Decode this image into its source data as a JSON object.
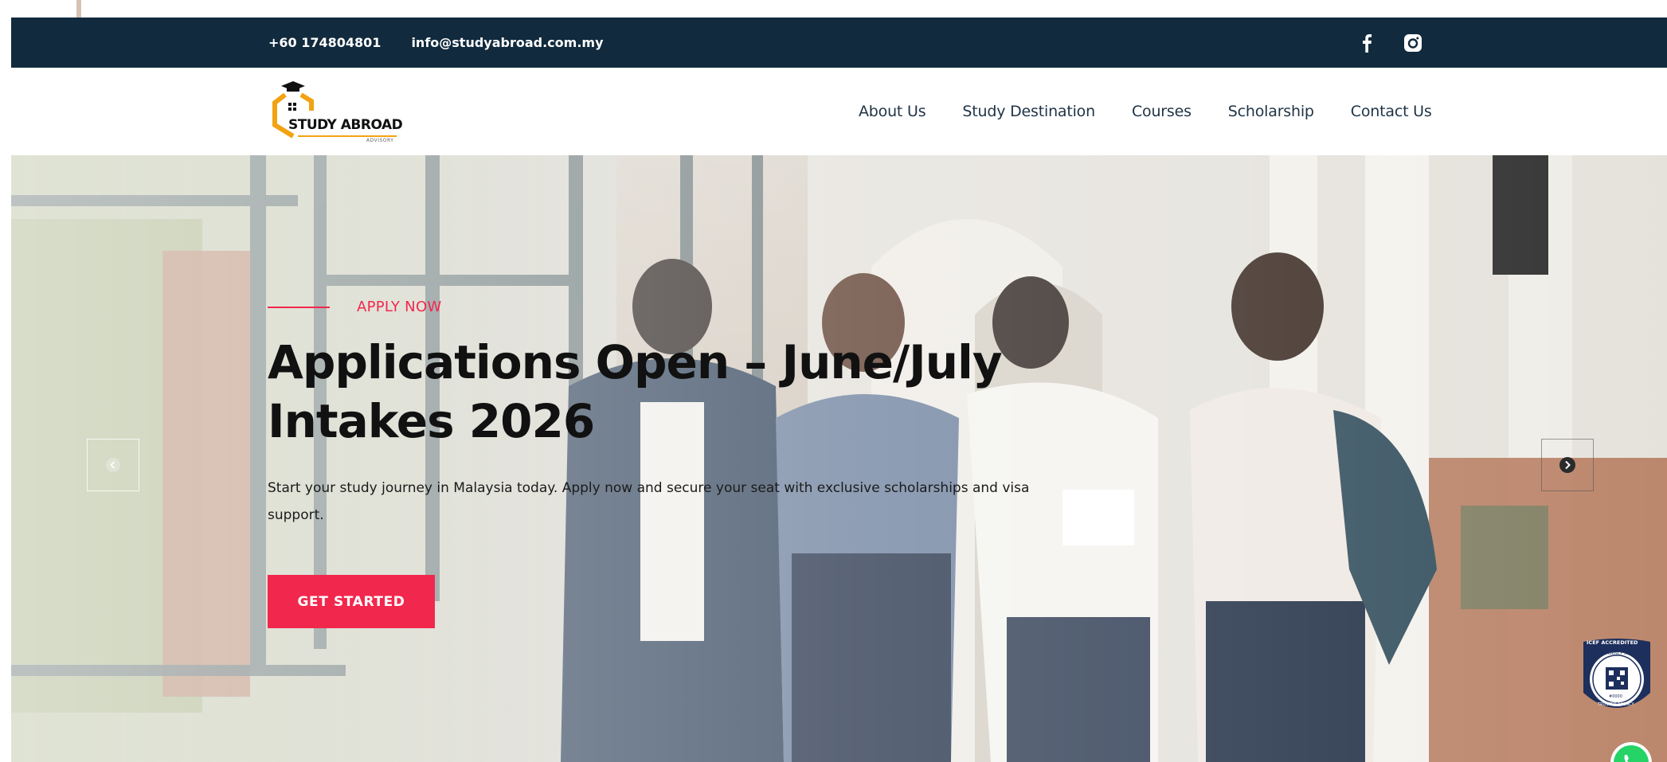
{
  "topbar": {
    "phone": "+60 174804801",
    "email": "info@studyabroad.com.my",
    "social": [
      {
        "icon": "facebook-icon"
      },
      {
        "icon": "instagram-icon"
      }
    ]
  },
  "logo": {
    "line1": "STUDY ABROAD",
    "line2": "ADVISORY"
  },
  "nav": {
    "items": [
      "About Us",
      "Study Destination",
      "Courses",
      "Scholarship",
      "Contact Us"
    ]
  },
  "hero": {
    "eyebrow": "APPLY NOW",
    "title_line1": "Applications Open – June/July",
    "title_line2": "Intakes 2026",
    "description": "Start your study journey in Malaysia today. Apply now and secure your seat with exclusive scholarships and visa support.",
    "cta": "GET STARTED"
  },
  "badge": {
    "top_text": "ICEF ACCREDITED",
    "ring_text": "ICEF AGENCY STATUS",
    "bottom_text": "TRUSTED AGENCY",
    "code": "#0000"
  },
  "colors": {
    "topbar_bg": "#112a3d",
    "accent": "#f2274d",
    "nav_text": "#1f3346"
  }
}
